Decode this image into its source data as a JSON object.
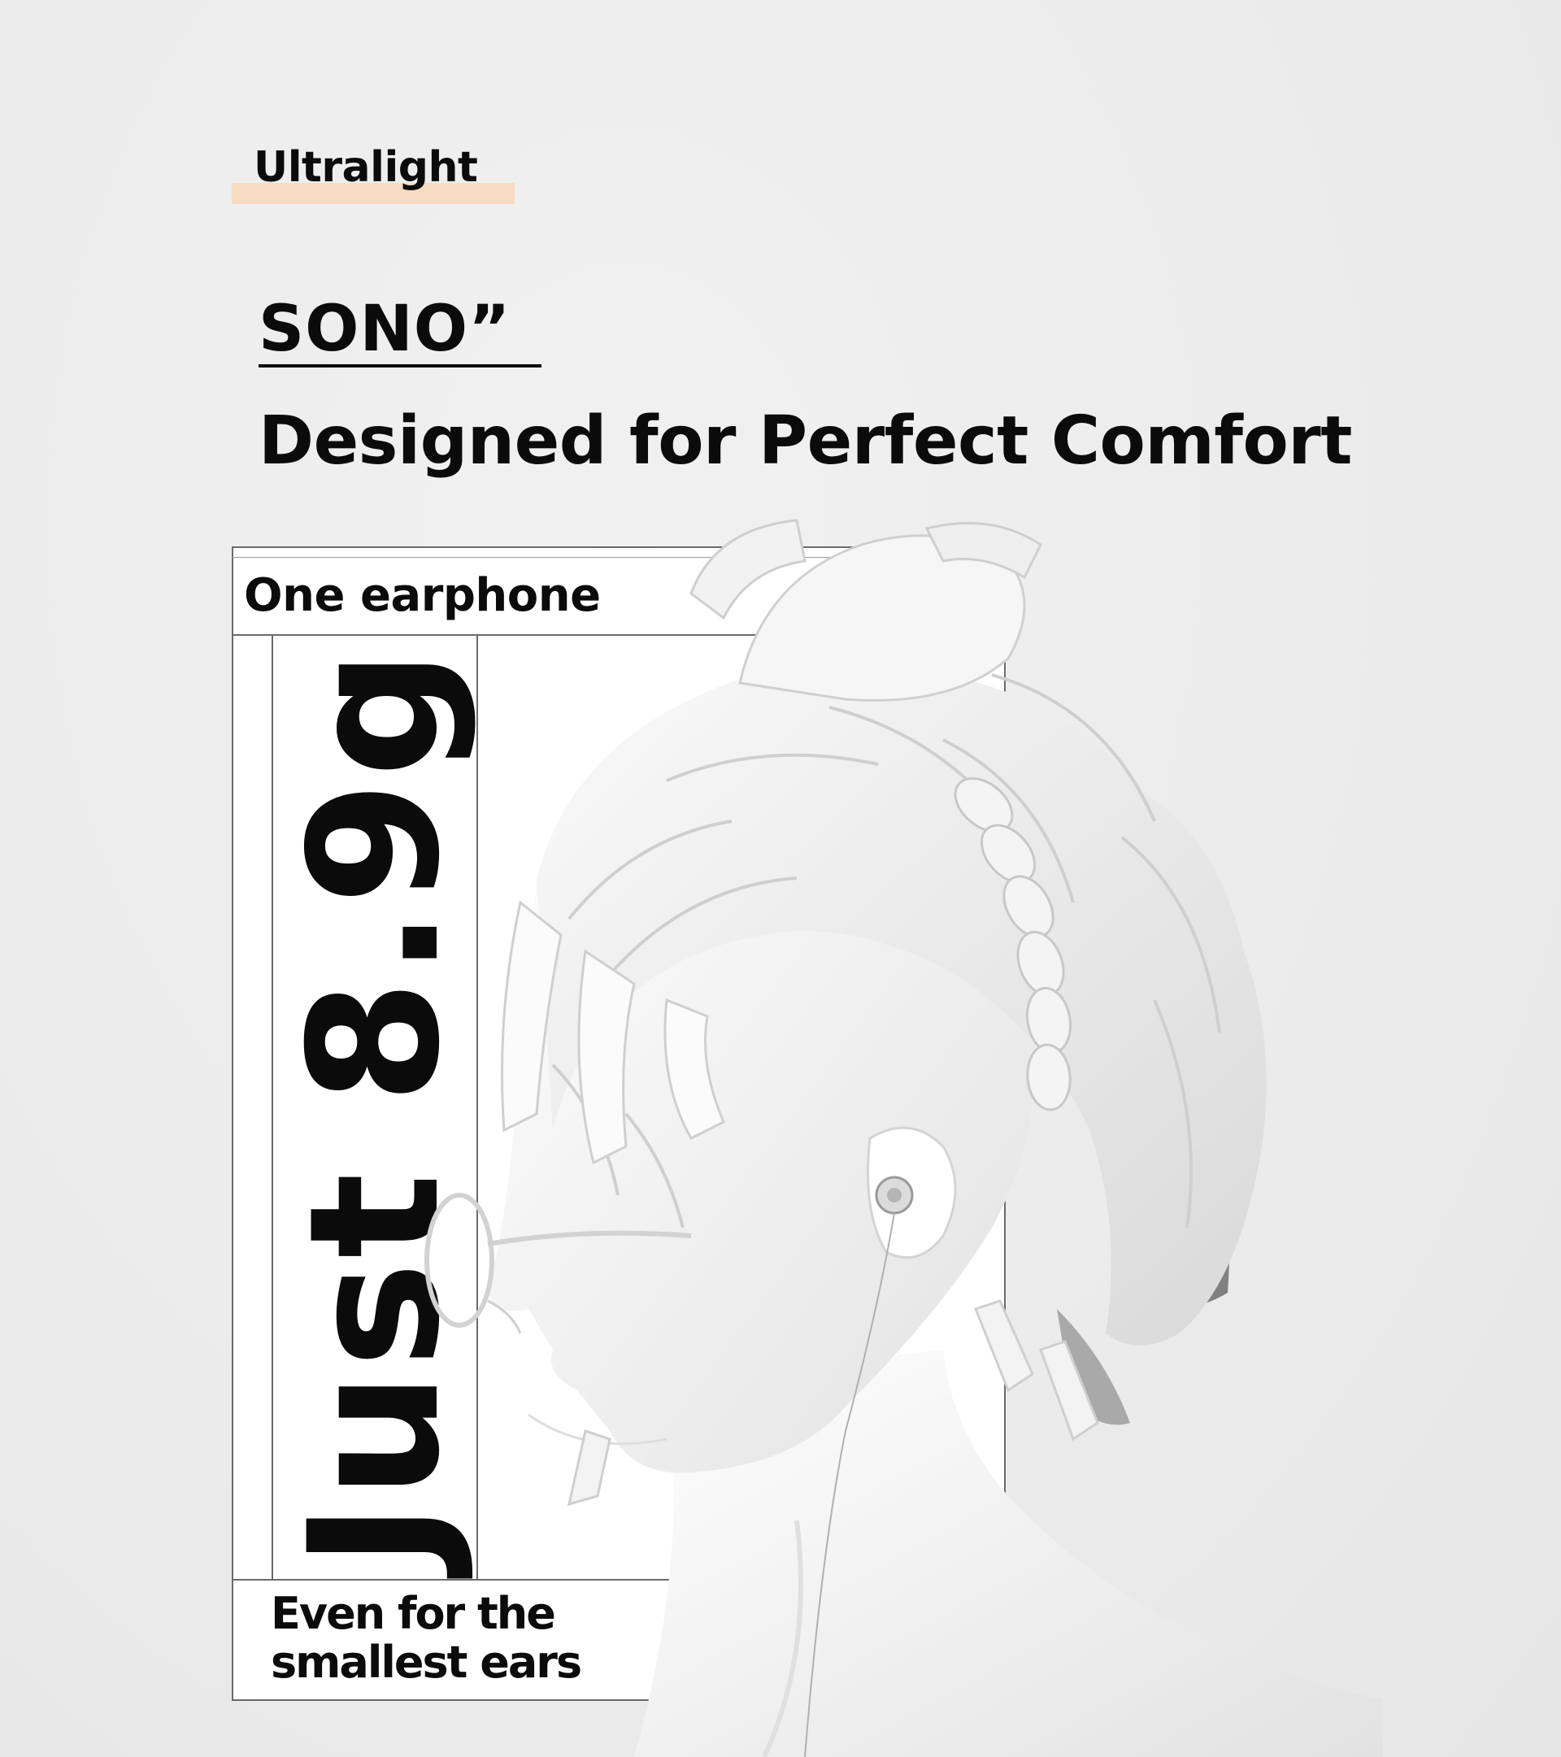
{
  "tag": {
    "label": "Ultralight",
    "highlight_color": "#f7dcc2"
  },
  "brand": {
    "name": "SONO”"
  },
  "headline": "Designed for Perfect Comfort",
  "card": {
    "label": "One earphone",
    "weight": "Just 8.9g",
    "footer_line1": "Even for the",
    "footer_line2": "smallest ears"
  },
  "illustration": {
    "icon": "white-3d-head-with-earphone-illustration"
  }
}
